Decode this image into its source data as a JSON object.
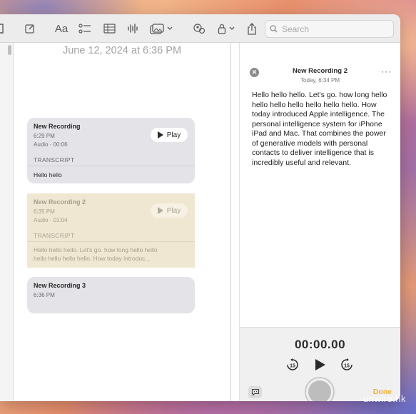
{
  "toolbar": {
    "font_button_label": "Aa",
    "search_placeholder": "Search",
    "icons": [
      "sidebar-icon",
      "compose-icon",
      "format-icon",
      "checklist-icon",
      "table-icon",
      "audio-waveform-icon",
      "media-icon",
      "chevron-down-icon",
      "collaborate-icon",
      "lock-icon",
      "chevron-down-icon",
      "share-icon",
      "search-icon"
    ]
  },
  "note": {
    "date": "June 12, 2024 at 6:36 PM",
    "recordings": [
      {
        "title": "New Recording",
        "time": "6:29 PM",
        "audio": "Audio · 00:06",
        "play_label": "Play",
        "transcript_label": "TRANSCRIPT",
        "transcript": "Hello hello"
      },
      {
        "title": "New Recording 2",
        "time": "6:35 PM",
        "audio": "Audio · 01:04",
        "play_label": "Play",
        "transcript_label": "TRANSCRIPT",
        "transcript_line1": "Hello hello hello. Let's go. how long hello hello",
        "transcript_line2": "hello hello hello hello. How today introduc..."
      },
      {
        "title": "New Recording 3",
        "time": "6:36 PM"
      }
    ]
  },
  "inspector": {
    "title": "New Recording 2",
    "subtitle": "Today, 6:34 PM",
    "more_label": "···",
    "body": "Hello hello hello.  Let's go.  how long hello hello hello hello  hello  hello hello. How today introduced Apple intelligence.  The personal intelligence system for iPhone iPad and Mac. That combines the power of generative models with personal  contacts to deliver intelligence that is incredibly useful and relevant.",
    "timer": "00:00.00",
    "skip_back_label": "15",
    "skip_forward_label": "15",
    "done_label": "Done"
  },
  "watermark": "unwire.hk",
  "colors": {
    "accent": "#f0b13d",
    "active_card": "#efe7d2",
    "card": "#e4e4e8"
  }
}
